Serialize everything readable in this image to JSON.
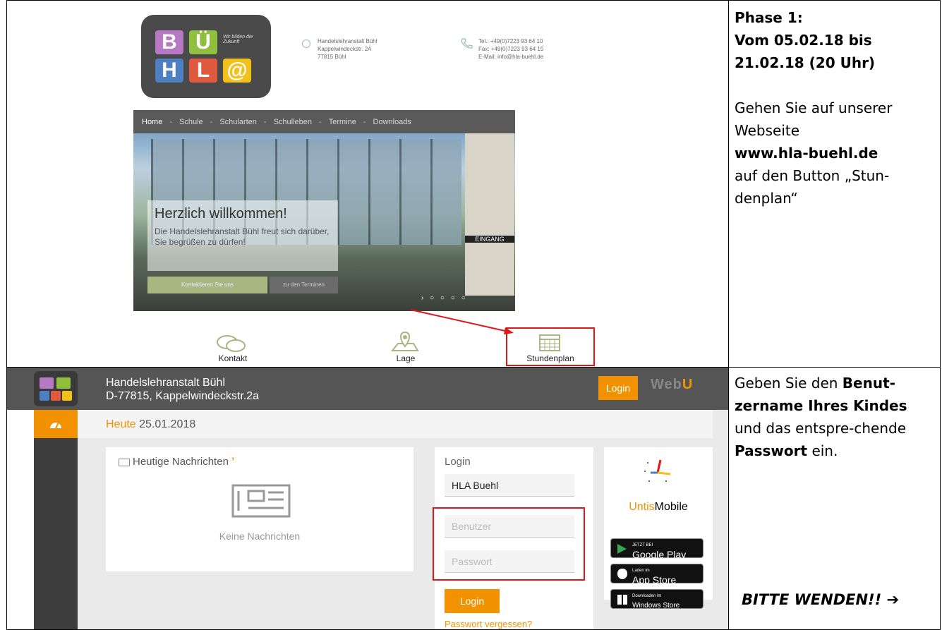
{
  "phase1": {
    "title_line1": "Phase 1:",
    "title_line2": "Vom 05.02.18 bis 21.02.18 (20 Uhr)",
    "text_before": "Gehen Sie auf unserer Webseite",
    "url": "www.hla-buehl.de",
    "text_after": "auf den Button „Stun-denplan“"
  },
  "phase2": {
    "text1": "Geben Sie den",
    "bold1": "Benut-zername Ihres Kindes",
    "text2": "und das entspre-chende",
    "bold2": "Passwort",
    "text3": "ein.",
    "bitte": "BITTE WENDEN!! ➔"
  },
  "website": {
    "logo_letters": [
      "B",
      "Ü",
      "H",
      "L",
      "@"
    ],
    "logo_slogan": "Wir bilden die Zukunft",
    "address": [
      "Handelslehranstalt Bühl",
      "Kappelwindeckstr. 2A",
      "77815 Bühl"
    ],
    "contact": [
      "Tel.: +49(0)7223 93 64 10",
      "Fax: +49(0)7223 93 64 15",
      "E-Mail: info@hla-buehl.de"
    ],
    "nav": [
      "Home",
      "Schule",
      "Schularten",
      "Schulleben",
      "Termine",
      "Downloads"
    ],
    "welcome_title": "Herzlich willkommen!",
    "welcome_text": "Die Handelslehranstalt Bühl freut sich darüber, Sie begrüßen zu dürfen!",
    "btn_contact": "Kontaktieren Sie uns",
    "btn_dates": "zu den Terminen",
    "eingang": "EINGANG",
    "icons": [
      {
        "label": "Kontakt"
      },
      {
        "label": "Lage"
      },
      {
        "label": "Stundenplan"
      }
    ]
  },
  "webuntis": {
    "school_name": "Handelslehranstalt Bühl",
    "school_addr": "D-77815, Kappelwindeckstr.2a",
    "login_btn": "Login",
    "brand_a": "Web",
    "brand_b": "U",
    "heute_label": "Heute",
    "heute_date": "25.01.2018",
    "news_title": "Heutige Nachrichten",
    "no_news": "Keine Nachrichten",
    "login_title": "Login",
    "school_field": "HLA Buehl",
    "user_placeholder": "Benutzer",
    "pass_placeholder": "Passwort",
    "submit": "Login",
    "forgot": "Passwort vergessen?",
    "untis_a": "Untis",
    "untis_b": "Mobile",
    "stores": [
      {
        "small": "JETZT BEI",
        "big": "Google Play"
      },
      {
        "small": "Laden im",
        "big": "App Store"
      },
      {
        "small": "Downloaden im",
        "big": "Windows Store"
      }
    ]
  },
  "colors": {
    "accent": "#f39200",
    "highlight": "#e0161b"
  }
}
